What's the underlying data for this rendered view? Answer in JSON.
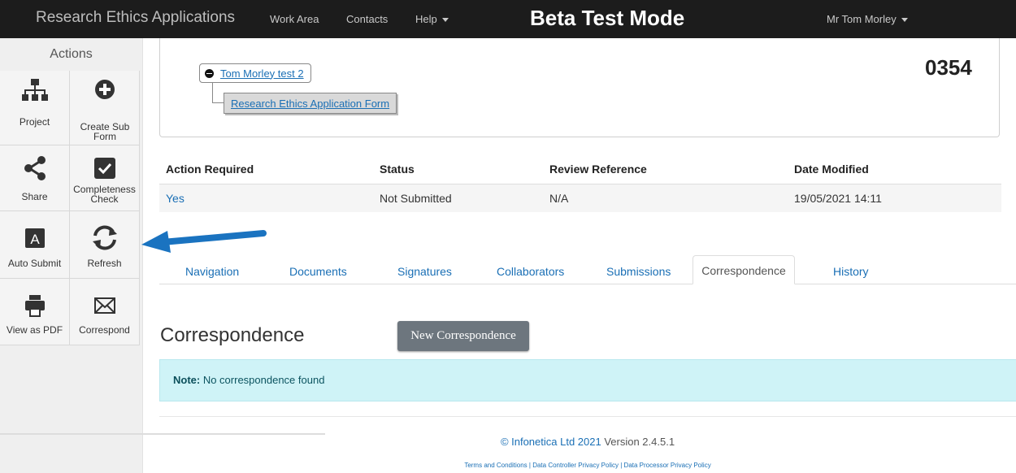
{
  "navbar": {
    "brand": "Research Ethics Applications",
    "work_area": "Work Area",
    "contacts": "Contacts",
    "help": "Help",
    "mode_banner": "Beta Test Mode",
    "user": "Mr Tom Morley"
  },
  "sidebar": {
    "title": "Actions",
    "tiles": [
      {
        "label": "Project",
        "icon": "sitemap-icon"
      },
      {
        "label": "Create Sub Form",
        "icon": "plus-circle-icon"
      },
      {
        "label": "Share",
        "icon": "share-icon"
      },
      {
        "label": "Completeness Check",
        "icon": "check-square-icon"
      },
      {
        "label": "Auto Submit",
        "icon": "letter-a-icon"
      },
      {
        "label": "Refresh",
        "icon": "refresh-icon"
      },
      {
        "label": "View as PDF",
        "icon": "printer-icon"
      },
      {
        "label": "Correspond",
        "icon": "envelope-icon"
      }
    ]
  },
  "tree": {
    "root": "Tom Morley test 2",
    "child": "Research Ethics Application Form",
    "app_id": "0354"
  },
  "status_table": {
    "headers": [
      "Action Required",
      "Status",
      "Review Reference",
      "Date Modified"
    ],
    "row": [
      "Yes",
      "Not Submitted",
      "N/A",
      "19/05/2021 14:11"
    ]
  },
  "tabs": [
    {
      "label": "Navigation"
    },
    {
      "label": "Documents"
    },
    {
      "label": "Signatures"
    },
    {
      "label": "Collaborators"
    },
    {
      "label": "Submissions"
    },
    {
      "label": "Correspondence",
      "active": true
    },
    {
      "label": "History"
    }
  ],
  "correspondence": {
    "title": "Correspondence",
    "new_button": "New Correspondence",
    "note_label": "Note:",
    "note_text": " No correspondence found"
  },
  "footer": {
    "copyright": "© Infonetica Ltd 2021",
    "version": " Version 2.4.5.1",
    "terms": "Terms and Conditions | Data Controller Privacy Policy | Data Processor Privacy Policy"
  },
  "colors": {
    "navbar_bg": "#1c1c1c",
    "link": "#1a6fb5",
    "arrow": "#1a73c0",
    "alert_bg": "#cff3f7",
    "button_bg": "#6d767e"
  }
}
